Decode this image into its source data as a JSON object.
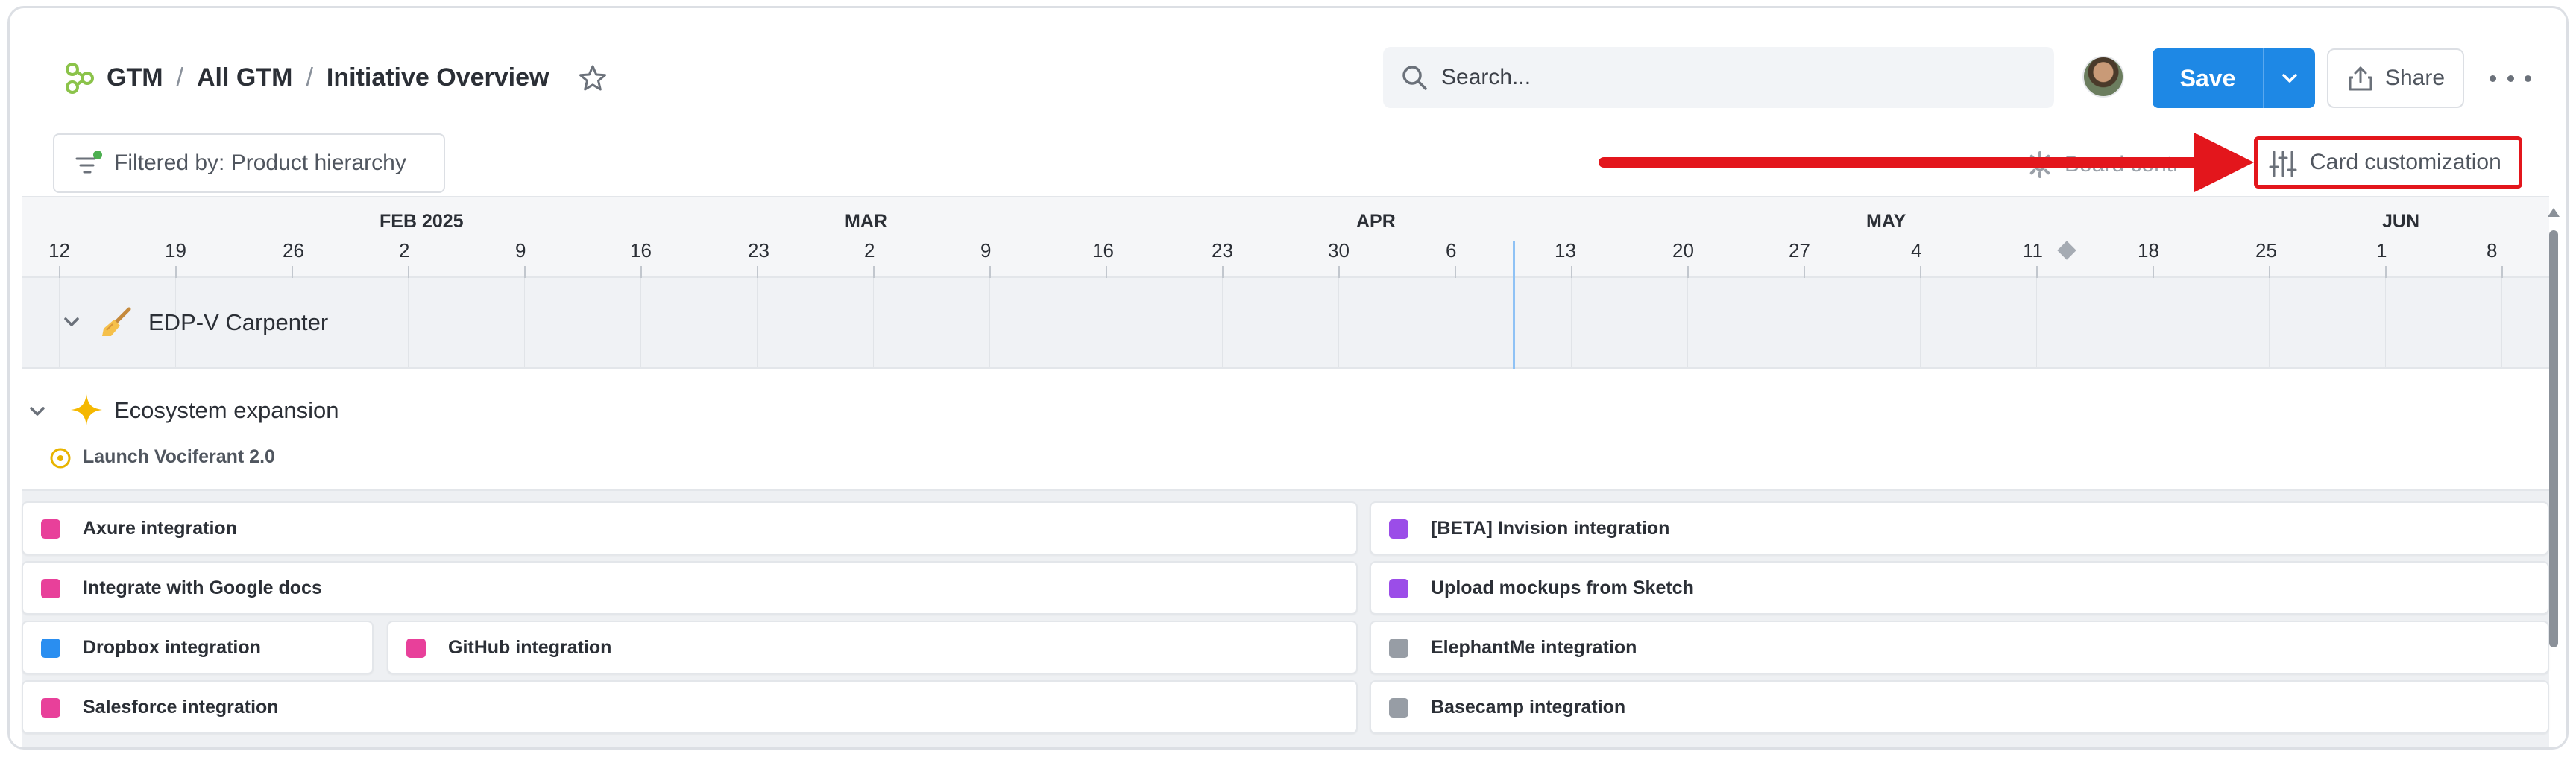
{
  "breadcrumb": {
    "root": "GTM",
    "sep1": "/",
    "middle": "All GTM",
    "sep2": "/",
    "current": "Initiative Overview"
  },
  "search": {
    "placeholder": "Search..."
  },
  "toolbar": {
    "save_label": "Save",
    "share_label": "Share"
  },
  "filter": {
    "label": "Filtered by: Product hierarchy"
  },
  "board_controls": {
    "label": "Board contr"
  },
  "card_customization": {
    "label": "Card customization"
  },
  "timeline": {
    "months": [
      "FEB 2025",
      "MAR",
      "APR",
      "MAY",
      "JUN"
    ],
    "weeks": [
      "12",
      "19",
      "26",
      "2",
      "9",
      "16",
      "23",
      "2",
      "9",
      "16",
      "23",
      "30",
      "6",
      "13",
      "20",
      "27",
      "4",
      "11",
      "18",
      "25",
      "1",
      "8"
    ]
  },
  "group": {
    "label": "EDP-V Carpenter"
  },
  "subgroup": {
    "label": "Ecosystem expansion",
    "goal": "Launch Vociferant 2.0"
  },
  "cards": [
    {
      "label": "Axure integration",
      "color": "#e8409a"
    },
    {
      "label": "[BETA] Invision integration",
      "color": "#9b4de8"
    },
    {
      "label": "Integrate with Google docs",
      "color": "#e8409a"
    },
    {
      "label": "Upload mockups from Sketch",
      "color": "#9b4de8"
    },
    {
      "label": "Dropbox integration",
      "color": "#2a8ef0"
    },
    {
      "label": "GitHub integration",
      "color": "#e8409a"
    },
    {
      "label": "ElephantMe integration",
      "color": "#979da5"
    },
    {
      "label": "Salesforce integration",
      "color": "#e8409a"
    },
    {
      "label": "Basecamp integration",
      "color": "#979da5"
    }
  ],
  "colors": {
    "accent": "#1e88e5",
    "highlight": "#e3161c",
    "logo": "#8bc34a"
  }
}
